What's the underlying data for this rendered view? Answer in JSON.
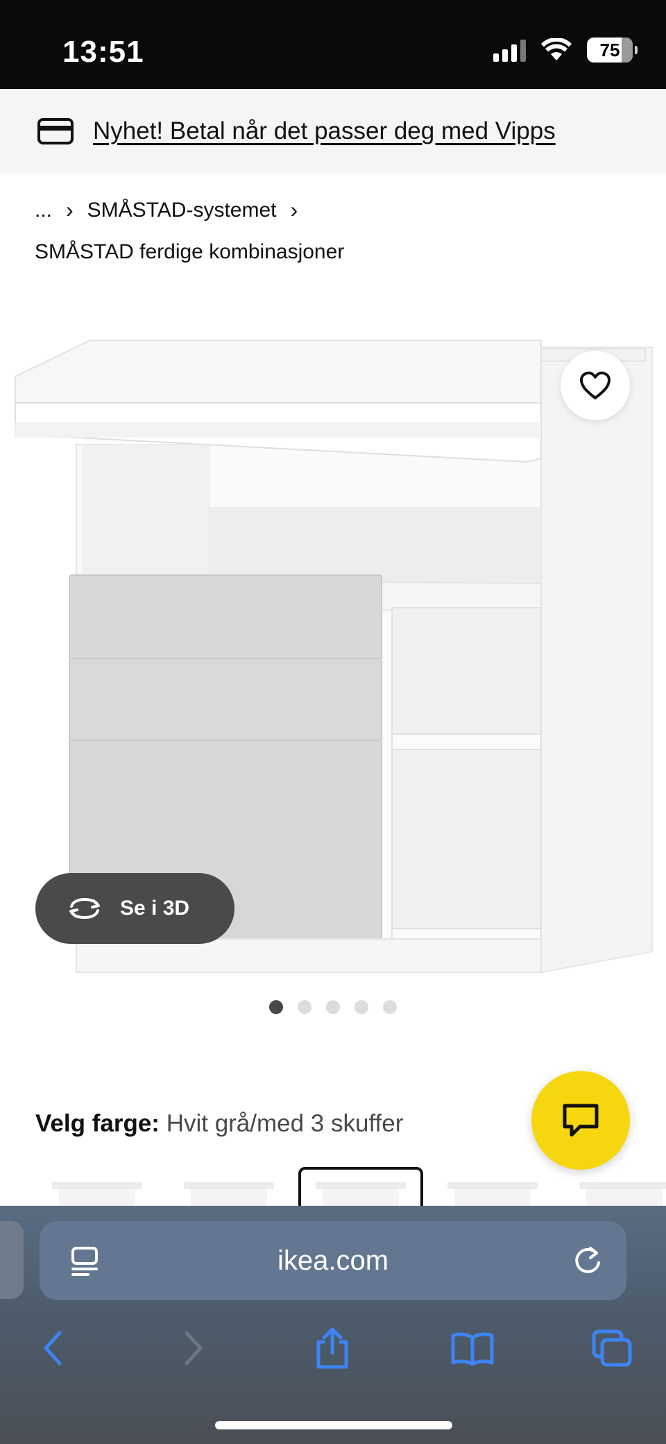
{
  "status_bar": {
    "time": "13:51",
    "battery": "75"
  },
  "promo": {
    "text": "Nyhet! Betal når det passer deg med Vipps"
  },
  "breadcrumb": {
    "ellipsis": "...",
    "separator": "›",
    "item1": "SMÅSTAD-systemet",
    "item2": "SMÅSTAD ferdige kombinasjoner"
  },
  "product": {
    "view3d_label": "Se i 3D",
    "image_count": 5,
    "active_image": 1
  },
  "color_selection": {
    "label": "Velg farge:",
    "value": "Hvit grå/med 3 skuffer"
  },
  "browser": {
    "url": "ikea.com"
  },
  "colors": {
    "chat_yellow": "#f6d60f",
    "ios_blue": "#3d84f5",
    "chrome_bg": "#596c80"
  },
  "icons": [
    "card-icon",
    "heart-icon",
    "rotate-3d-icon",
    "chat-icon",
    "reader-icon",
    "reload-icon",
    "back-icon",
    "forward-icon",
    "share-icon",
    "bookmarks-icon",
    "tabs-icon"
  ]
}
